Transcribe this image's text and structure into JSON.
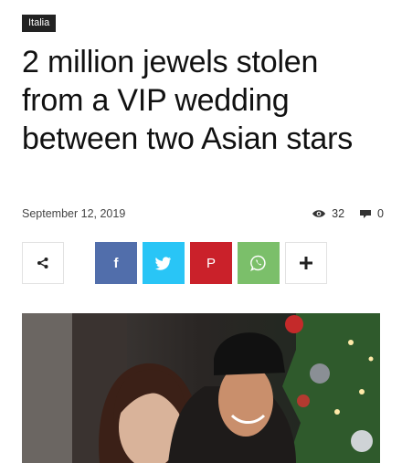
{
  "category": "Italia",
  "title": "2 million jewels stolen from a VIP wedding between two Asian stars",
  "meta": {
    "date": "September 12, 2019",
    "views": "32",
    "comments": "0",
    "views_icon": "eye-icon",
    "comments_icon": "comment-icon"
  },
  "share": {
    "buttons": [
      {
        "name": "share",
        "icon": "share-icon"
      },
      {
        "name": "facebook",
        "label": "f",
        "color": "#516eab"
      },
      {
        "name": "twitter",
        "icon": "twitter-icon",
        "color": "#29c5f6"
      },
      {
        "name": "pinterest",
        "label": "P",
        "color": "#ca212a"
      },
      {
        "name": "whatsapp",
        "icon": "whatsapp-icon",
        "color": "#7bbf6a"
      },
      {
        "name": "more",
        "icon": "plus-icon"
      }
    ]
  }
}
